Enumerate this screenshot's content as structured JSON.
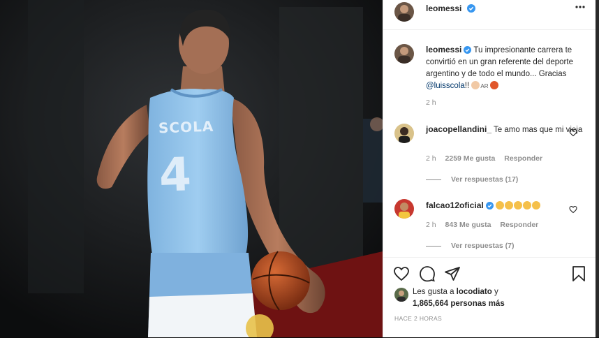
{
  "post": {
    "username": "leomessi",
    "more_icon": "more-icon",
    "jersey_name": "SCOLA",
    "jersey_number": "4"
  },
  "caption": {
    "username": "leomessi",
    "text": "Tu impresionante carrera te convirtió en un gran referente del deporte argentino y de todo el mundo... Gracias",
    "mention": "@luisscola",
    "suffix": "!!",
    "flag_text": "AR",
    "time": "2 h"
  },
  "comments": [
    {
      "username": "joacopellandini_",
      "text": "Te amo mas que mi vieja",
      "time": "2 h",
      "likes": "2259 Me gusta",
      "reply": "Responder",
      "view_replies": "Ver respuestas (17)"
    },
    {
      "username": "falcao12oficial",
      "text": "",
      "time": "2 h",
      "likes": "843 Me gusta",
      "reply": "Responder",
      "view_replies": "Ver respuestas (7)"
    }
  ],
  "likes": {
    "prefix": "Les gusta a",
    "user": "locodiato",
    "conj": "y",
    "count": "1,865,664",
    "suffix": "personas más"
  },
  "posted_ago": "HACE 2 HORAS",
  "colors": {
    "verified": "#3897f0",
    "link": "#00376b",
    "jersey": "#8cbfe8",
    "floor": "#7a1414"
  }
}
